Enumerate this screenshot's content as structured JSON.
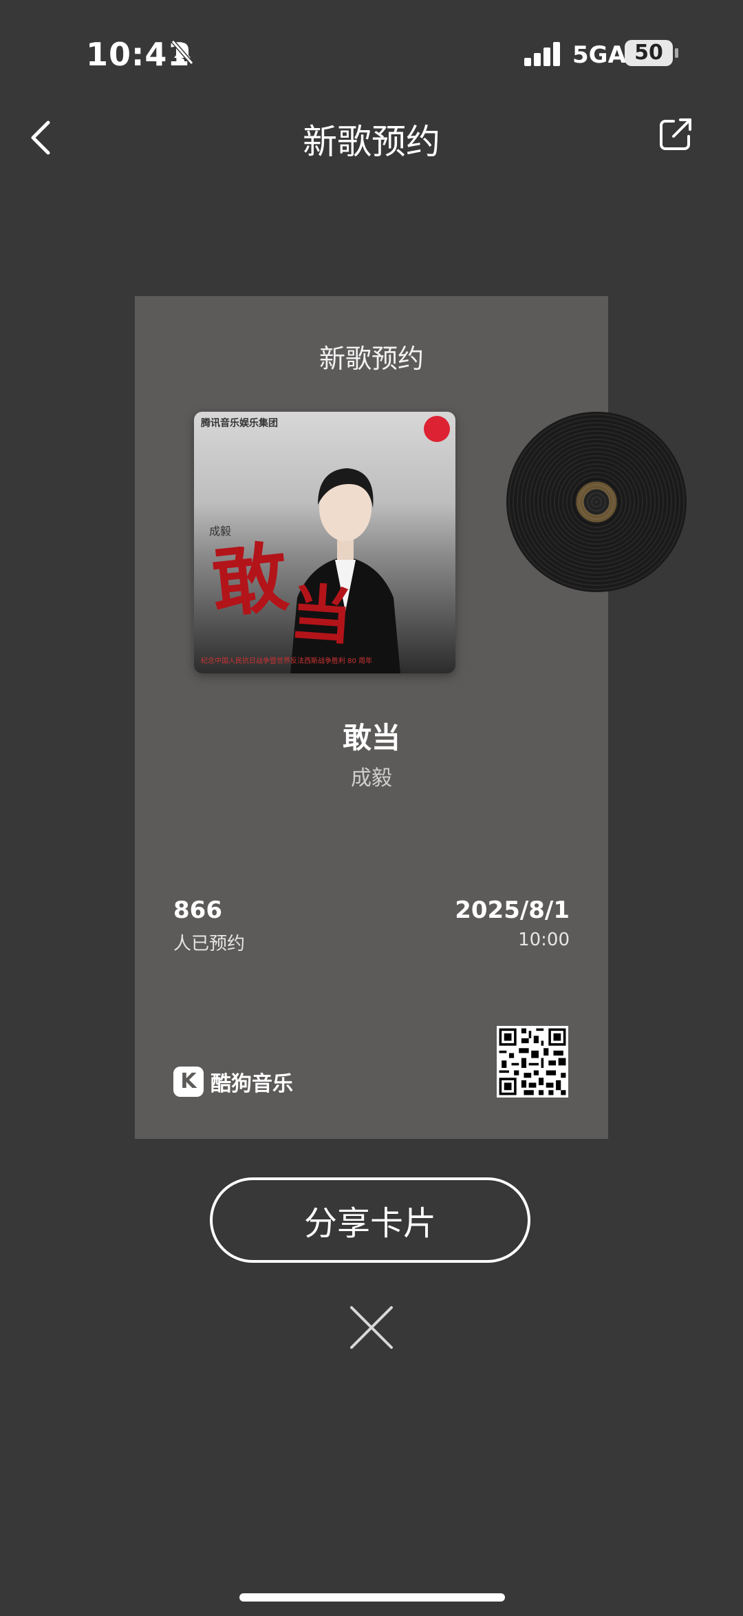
{
  "status_bar": {
    "time": "10:41",
    "network": "5GA",
    "battery": "50"
  },
  "nav": {
    "title": "新歌预约"
  },
  "card": {
    "title": "新歌预约",
    "cover": {
      "header_text": "腾讯音乐娱乐集团",
      "artist_small": "成毅",
      "title_char_1": "敢",
      "title_char_2": "当",
      "footer_text": "纪念中国人民抗日战争暨世界反法西斯战争胜利 80 周年"
    },
    "song_title": "敢当",
    "artist": "成毅",
    "reservations_count": "866",
    "reservations_label": "人已预约",
    "release_date": "2025/8/1",
    "release_time": "10:00",
    "brand_logo": "K",
    "brand_name": "酷狗音乐"
  },
  "actions": {
    "share_button": "分享卡片"
  },
  "colors": {
    "background": "#383838",
    "card": "#5d5b5a",
    "accent_red": "#b3141a"
  },
  "icons": {
    "back": "chevron-left-icon",
    "share": "share-external-icon",
    "close": "close-icon",
    "mute": "bell-slash-icon"
  }
}
